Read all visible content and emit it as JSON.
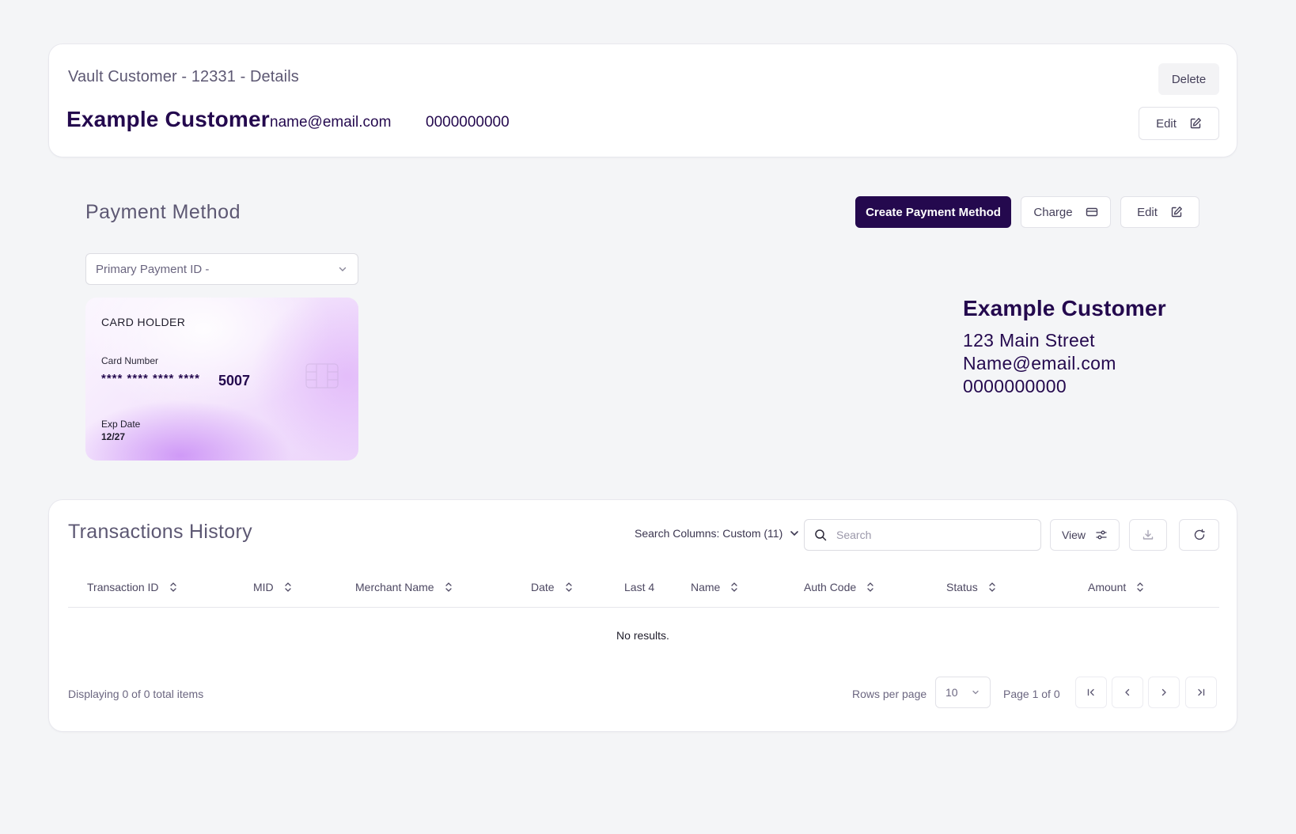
{
  "details": {
    "title": "Vault Customer - 12331 - Details",
    "customer_name": "Example Customer",
    "email": "name@email.com",
    "phone": "0000000000",
    "delete_label": "Delete",
    "edit_label": "Edit"
  },
  "payment_method": {
    "title": "Payment Method",
    "create_label": "Create Payment Method",
    "charge_label": "Charge",
    "edit_label": "Edit",
    "select_value": "Primary Payment ID -",
    "card": {
      "holder_label": "CARD HOLDER",
      "number_label": "Card Number",
      "masked": "**** **** **** ****",
      "last4": "5007",
      "exp_label": "Exp Date",
      "exp": "12/27"
    },
    "billing": {
      "name": "Example Customer",
      "street": "123 Main Street",
      "email": "Name@email.com",
      "phone": "0000000000"
    }
  },
  "transactions": {
    "title": "Transactions History",
    "search_columns_label": "Search Columns: Custom (11)",
    "search_placeholder": "Search",
    "view_label": "View",
    "columns": [
      "Transaction ID",
      "MID",
      "Merchant Name",
      "Date",
      "Last 4",
      "Name",
      "Auth Code",
      "Status",
      "Amount"
    ],
    "empty_text": "No results.",
    "displaying_text": "Displaying 0 of 0 total items",
    "rows_per_page_label": "Rows per page",
    "rows_per_page_value": "10",
    "page_text": "Page 1 of 0"
  },
  "colors": {
    "brand": "#24094e",
    "muted_text": "#5d5873",
    "background": "#f4f5f7"
  },
  "icons": [
    "edit-icon",
    "card-icon",
    "chevron-down-icon",
    "search-icon",
    "sliders-icon",
    "download-icon",
    "refresh-icon",
    "sort-icon",
    "first-page-icon",
    "prev-page-icon",
    "next-page-icon",
    "last-page-icon",
    "card-chip-icon"
  ]
}
